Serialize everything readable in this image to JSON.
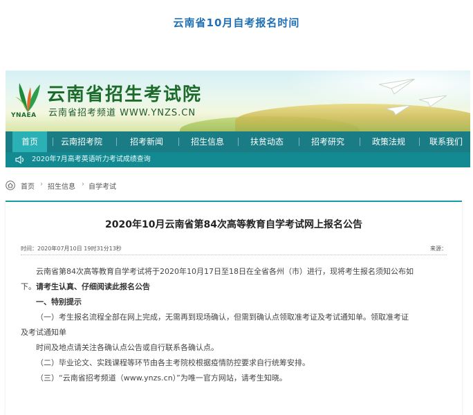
{
  "article": {
    "title": "云南省10月自考报名时间"
  },
  "site": {
    "name": "云南省招生考试院",
    "subtitle": "云南省招考频道 WWW.YNZS.CN",
    "logo_caption": "YNAEA"
  },
  "nav": {
    "items": [
      {
        "label": "首页",
        "active": true
      },
      {
        "label": "云南招考院"
      },
      {
        "label": "招考新闻"
      },
      {
        "label": "招生信息"
      },
      {
        "label": "扶贫动态"
      },
      {
        "label": "招考研究"
      },
      {
        "label": "政策法规"
      },
      {
        "label": "联系我们"
      }
    ]
  },
  "notice": {
    "icon": "speaker-icon",
    "text": "2020年7月高考英语听力考试成绩查询"
  },
  "breadcrumb": {
    "icon": "home-icon",
    "items": [
      "首页",
      "招生信息",
      "自学考试"
    ]
  },
  "post": {
    "title": "2020年10月云南省第84次高等教育自学考试网上报名公告",
    "time": "时间：2020年07月10日 19时31分13秒",
    "source": "来源：",
    "para1a": "云南省第84次高等教育自学考试将于2020年10月17日至18日在全省各州（市）进行，现将考生报名须知公布如",
    "para1b_plain": "下。",
    "para1b_bold": "请考生认真、仔细阅读此报名公告",
    "section1": "一、特别提示",
    "item1a": "（一）考生报名流程全部在网上完成，无需再到现场确认，但需到确认点领取准考证及考试通知单。领取准考证",
    "item1b": "及考试通知单",
    "item1c": "时间及地点请关注各确认点公告或自行联系各确认点。",
    "item2": "（二）毕业论文、实践课程等环节由各主考院校根据疫情防控要求自行统筹安排。",
    "item3": "（三）“云南省招考频道（www.ynzs.cn）”为唯一官方网站，请考生知晓。"
  },
  "colors": {
    "nav": "#1a7d86",
    "nav_active": "#2bb0b6",
    "notice": "#138992",
    "title_blue": "#1f6fb5",
    "logo_green": "#1c6b2a"
  }
}
